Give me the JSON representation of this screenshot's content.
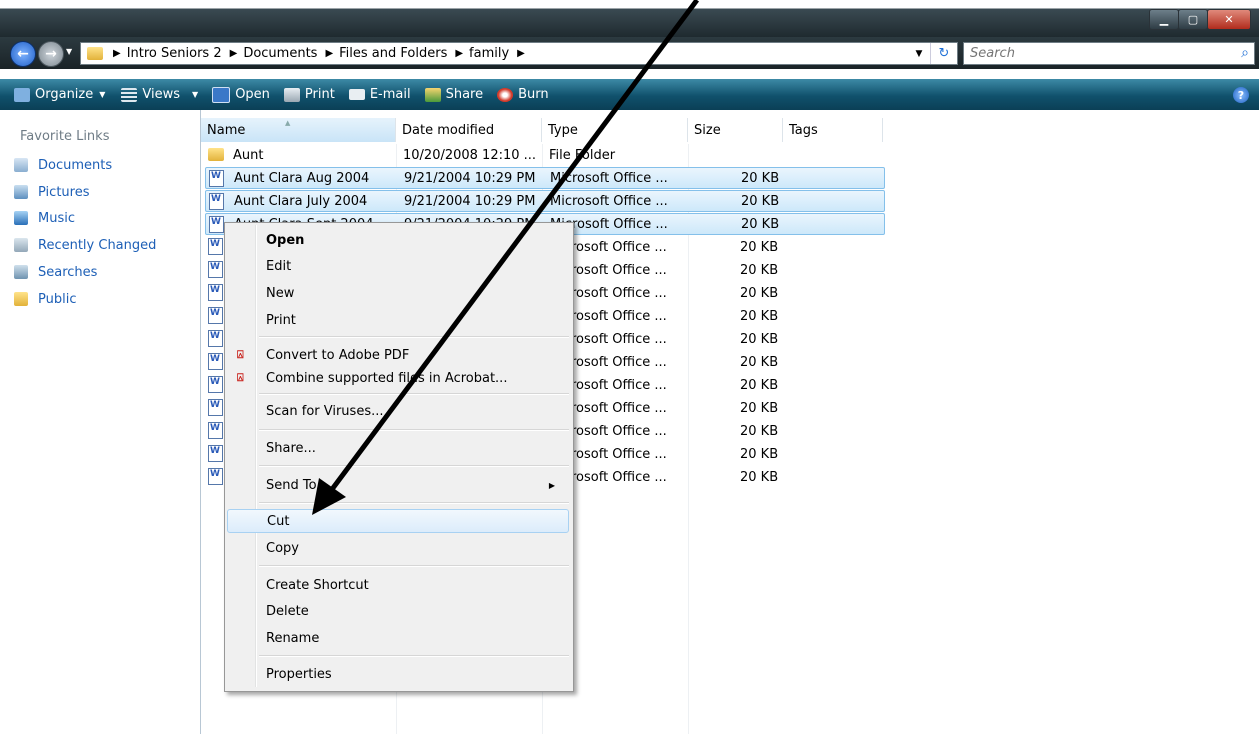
{
  "address": {
    "crumbs": [
      "Intro Seniors 2",
      "Documents",
      "Files and Folders",
      "family"
    ]
  },
  "search": {
    "placeholder": "Search"
  },
  "toolbar": {
    "organize": "Organize",
    "views": "Views",
    "open": "Open",
    "print": "Print",
    "email": "E-mail",
    "share": "Share",
    "burn": "Burn"
  },
  "nav": {
    "title": "Favorite Links",
    "items": [
      "Documents",
      "Pictures",
      "Music",
      "Recently Changed",
      "Searches",
      "Public"
    ]
  },
  "columns": {
    "name": "Name",
    "date": "Date modified",
    "type": "Type",
    "size": "Size",
    "tags": "Tags"
  },
  "files": [
    {
      "name": "Aunt",
      "date": "10/20/2008 12:10 ...",
      "type": "File Folder",
      "size": ""
    },
    {
      "name": "Aunt Clara Aug 2004",
      "date": "9/21/2004 10:29 PM",
      "type": "Microsoft Office ...",
      "size": "20 KB"
    },
    {
      "name": "Aunt Clara July 2004",
      "date": "9/21/2004 10:29 PM",
      "type": "Microsoft Office ...",
      "size": "20 KB"
    },
    {
      "name": "Aunt Clara Sept 2004",
      "date": "9/21/2004 10:29 PM",
      "type": "Microsoft Office ...",
      "size": "20 KB"
    },
    {
      "type": "Microsoft Office ...",
      "size": "20 KB"
    },
    {
      "type": "Microsoft Office ...",
      "size": "20 KB"
    },
    {
      "type": "Microsoft Office ...",
      "size": "20 KB"
    },
    {
      "type": "Microsoft Office ...",
      "size": "20 KB"
    },
    {
      "type": "Microsoft Office ...",
      "size": "20 KB"
    },
    {
      "type": "Microsoft Office ...",
      "size": "20 KB"
    },
    {
      "type": "Microsoft Office ...",
      "size": "20 KB"
    },
    {
      "type": "Microsoft Office ...",
      "size": "20 KB"
    },
    {
      "type": "Microsoft Office ...",
      "size": "20 KB"
    },
    {
      "type": "Microsoft Office ...",
      "size": "20 KB"
    },
    {
      "type": "Microsoft Office ...",
      "size": "20 KB"
    }
  ],
  "menu": {
    "open": "Open",
    "edit": "Edit",
    "new": "New",
    "print": "Print",
    "convert_pdf": "Convert to Adobe PDF",
    "combine": "Combine supported files in Acrobat...",
    "scan": "Scan for Viruses...",
    "share": "Share...",
    "send_to": "Send To",
    "cut": "Cut",
    "copy": "Copy",
    "create_shortcut": "Create Shortcut",
    "delete": "Delete",
    "rename": "Rename",
    "properties": "Properties"
  }
}
